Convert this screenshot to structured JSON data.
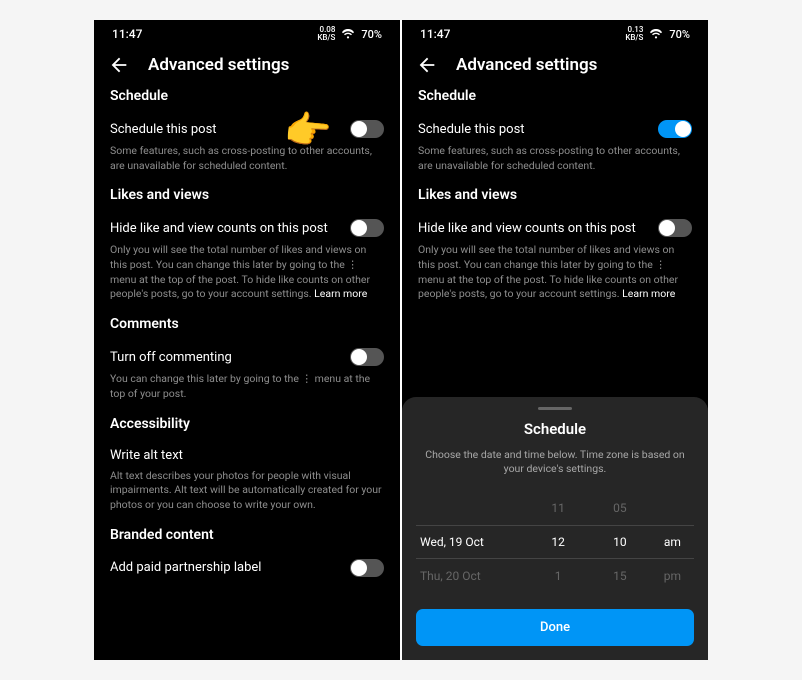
{
  "status": {
    "time": "11:47",
    "net1": "0.08",
    "net1_unit": "KB/S",
    "net2": "0.13",
    "net2_unit": "KB/S",
    "battery": "70%"
  },
  "header": {
    "title": "Advanced settings"
  },
  "schedule": {
    "section": "Schedule",
    "row_label": "Schedule this post",
    "desc": "Some features, such as cross-posting to other accounts, are unavailable for scheduled content."
  },
  "likes": {
    "section": "Likes and views",
    "row_label": "Hide like and view counts on this post",
    "desc": "Only you will see the total number of likes and views on this post. You can change this later by going to the ⋮ menu at the top of the post. To hide like counts on other people's posts, go to your account settings. ",
    "learn_more": "Learn more"
  },
  "comments": {
    "section": "Comments",
    "row_label": "Turn off commenting",
    "desc": "You can change this later by going to the ⋮ menu at the top of your post."
  },
  "accessibility": {
    "section": "Accessibility",
    "row_label": "Write alt text",
    "desc": "Alt text describes your photos for people with visual impairments. Alt text will be automatically created for your photos or you can choose to write your own."
  },
  "branded": {
    "section": "Branded content",
    "row_label": "Add paid partnership label"
  },
  "sheet": {
    "title": "Schedule",
    "desc": "Choose the date and time below. Time zone is based on your device's settings.",
    "date_prev": "",
    "date_sel": "Wed, 19 Oct",
    "date_next": "Thu, 20 Oct",
    "hour_prev": "11",
    "hour_sel": "12",
    "hour_next": "1",
    "min_prev": "05",
    "min_sel": "10",
    "min_next": "15",
    "ampm_prev": "",
    "ampm_sel": "am",
    "ampm_next": "pm",
    "done": "Done"
  }
}
